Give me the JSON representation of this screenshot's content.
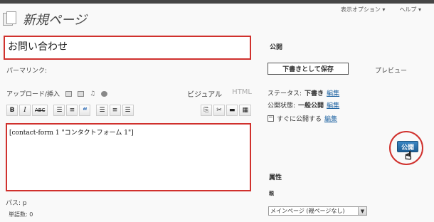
{
  "header": {
    "title": "新規ページ",
    "screen_options": "表示オプション ▾",
    "help": "ヘルプ ▾"
  },
  "editor": {
    "title_value": "お問い合わせ",
    "permalink_label": "パーマリンク:",
    "upload_label": "アップロード/挿入",
    "tab_visual": "ビジュアル",
    "tab_html": "HTML",
    "content": "[contact-form 1 \"コンタクトフォーム 1\"]",
    "path": "パス: p",
    "word_count": "単語数: 0",
    "toolbar": {
      "bold": "B",
      "italic": "I",
      "strike": "ABC",
      "blockquote": "“"
    }
  },
  "publish": {
    "heading": "公開",
    "save_draft": "下書きとして保存",
    "preview": "プレビュー",
    "status_label": "ステータス:",
    "status_value": "下書き",
    "visibility_label": "公開状態:",
    "visibility_value": "一般公開",
    "schedule_label": "すぐに公開する",
    "edit_link": "編集",
    "publish_button": "公開"
  },
  "attributes": {
    "heading": "属性",
    "parent_label": "親",
    "parent_value": "メインページ (親ページなし)"
  },
  "colors": {
    "highlight": "#d0312d",
    "link": "#2165a3",
    "publish_btn": "#2a6fa8"
  }
}
